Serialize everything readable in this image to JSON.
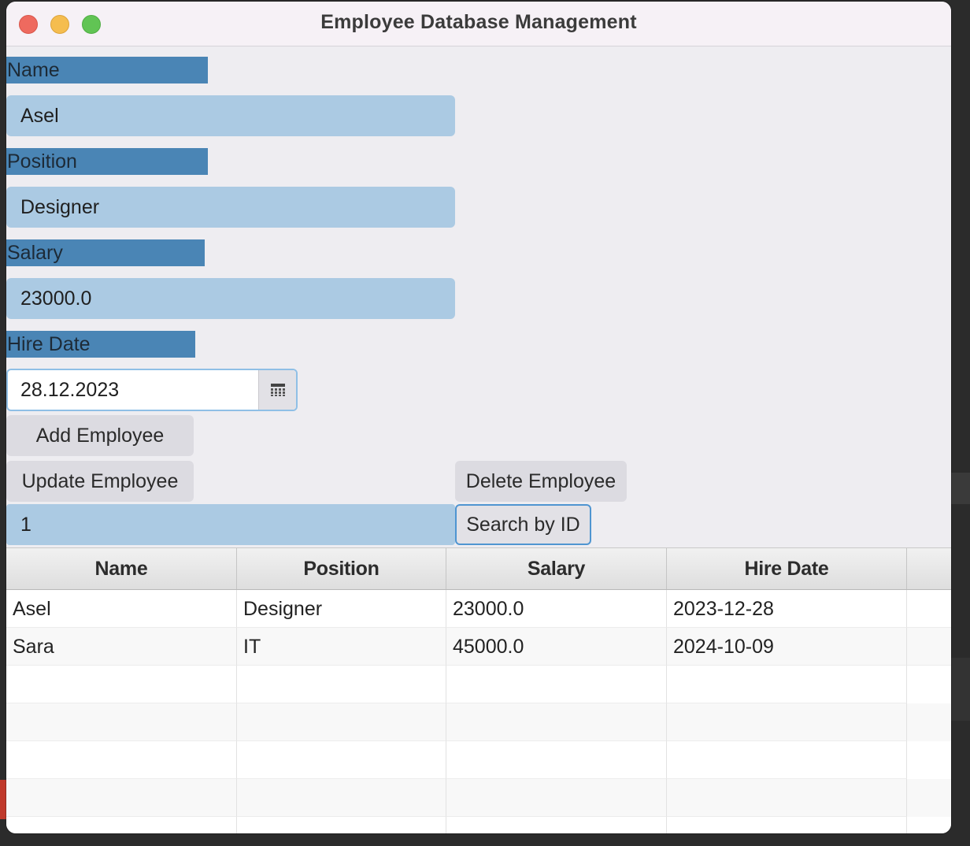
{
  "window": {
    "title": "Employee Database Management"
  },
  "form": {
    "name_label": "Name",
    "name_value": "Asel",
    "position_label": "Position",
    "position_value": "Designer",
    "salary_label": "Salary",
    "salary_value": "23000.0",
    "hire_date_label": "Hire Date",
    "hire_date_value": "28.12.2023"
  },
  "actions": {
    "add_label": "Add Employee",
    "update_label": "Update Employee",
    "delete_label": "Delete Employee",
    "search_value": "1",
    "search_label": "Search by ID"
  },
  "table": {
    "columns": [
      "Name",
      "Position",
      "Salary",
      "Hire Date"
    ],
    "rows": [
      [
        "Asel",
        "Designer",
        "23000.0",
        "2023-12-28"
      ],
      [
        "Sara",
        "IT",
        "45000.0",
        "2024-10-09"
      ]
    ]
  },
  "icons": {
    "date_picker_button": "calendar-icon"
  },
  "colors": {
    "label_bg": "#4a85b5",
    "input_bg": "#abcae3",
    "button_bg": "#dcdbe1",
    "focus_border": "#4f95d1"
  }
}
